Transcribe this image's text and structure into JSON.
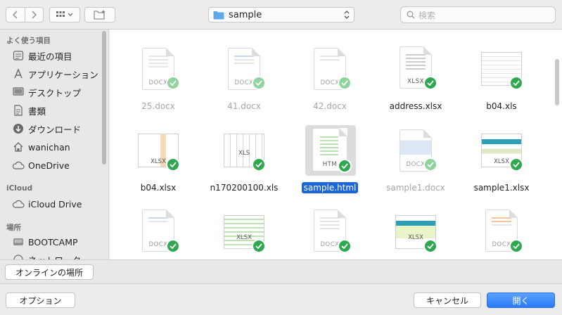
{
  "toolbar": {
    "path_label": "sample",
    "search_placeholder": "検索"
  },
  "sidebar": {
    "sections": [
      {
        "title": "よく使う項目"
      },
      {
        "title": "iCloud"
      },
      {
        "title": "場所"
      }
    ],
    "favorites": [
      {
        "label": "最近の項目",
        "icon": "clock-icon"
      },
      {
        "label": "アプリケーション",
        "icon": "applications-icon"
      },
      {
        "label": "デスクトップ",
        "icon": "desktop-icon"
      },
      {
        "label": "書類",
        "icon": "documents-icon"
      },
      {
        "label": "ダウンロード",
        "icon": "download-icon"
      },
      {
        "label": "wanichan",
        "icon": "home-icon"
      },
      {
        "label": "OneDrive",
        "icon": "cloud-icon"
      }
    ],
    "icloud": [
      {
        "label": "iCloud Drive",
        "icon": "cloud-icon"
      }
    ],
    "places": [
      {
        "label": "BOOTCAMP",
        "icon": "disk-icon"
      },
      {
        "label": "ネットワーク",
        "icon": "network-icon"
      }
    ]
  },
  "files": [
    {
      "name": "25.docx",
      "ext": "DOCX",
      "dim": true
    },
    {
      "name": "41.docx",
      "ext": "DOCX",
      "dim": true
    },
    {
      "name": "42.docx",
      "ext": "DOCX",
      "dim": true
    },
    {
      "name": "address.xlsx",
      "ext": "XLSX",
      "dim": false
    },
    {
      "name": "b04.xls",
      "ext": "",
      "dim": false
    },
    {
      "name": "b04.xlsx",
      "ext": "XLSX",
      "dim": false
    },
    {
      "name": "n170200100.xls",
      "ext": "XLS",
      "dim": false
    },
    {
      "name": "sample.html",
      "ext": "HTM",
      "dim": false,
      "selected": true
    },
    {
      "name": "sample1.docx",
      "ext": "DOCX",
      "dim": true
    },
    {
      "name": "sample1.xlsx",
      "ext": "XLSX",
      "dim": false
    },
    {
      "name": "",
      "ext": "DOCX",
      "dim": false
    },
    {
      "name": "",
      "ext": "XLSX",
      "dim": false
    },
    {
      "name": "",
      "ext": "DOCX",
      "dim": false
    },
    {
      "name": "",
      "ext": "XLSX",
      "dim": false
    },
    {
      "name": "",
      "ext": "DOCX",
      "dim": false
    }
  ],
  "buttons": {
    "online_locations": "オンラインの場所",
    "options": "オプション",
    "cancel": "キャンセル",
    "open": "開く"
  },
  "colors": {
    "accent": "#2c7bf5",
    "check": "#2fa84f"
  }
}
